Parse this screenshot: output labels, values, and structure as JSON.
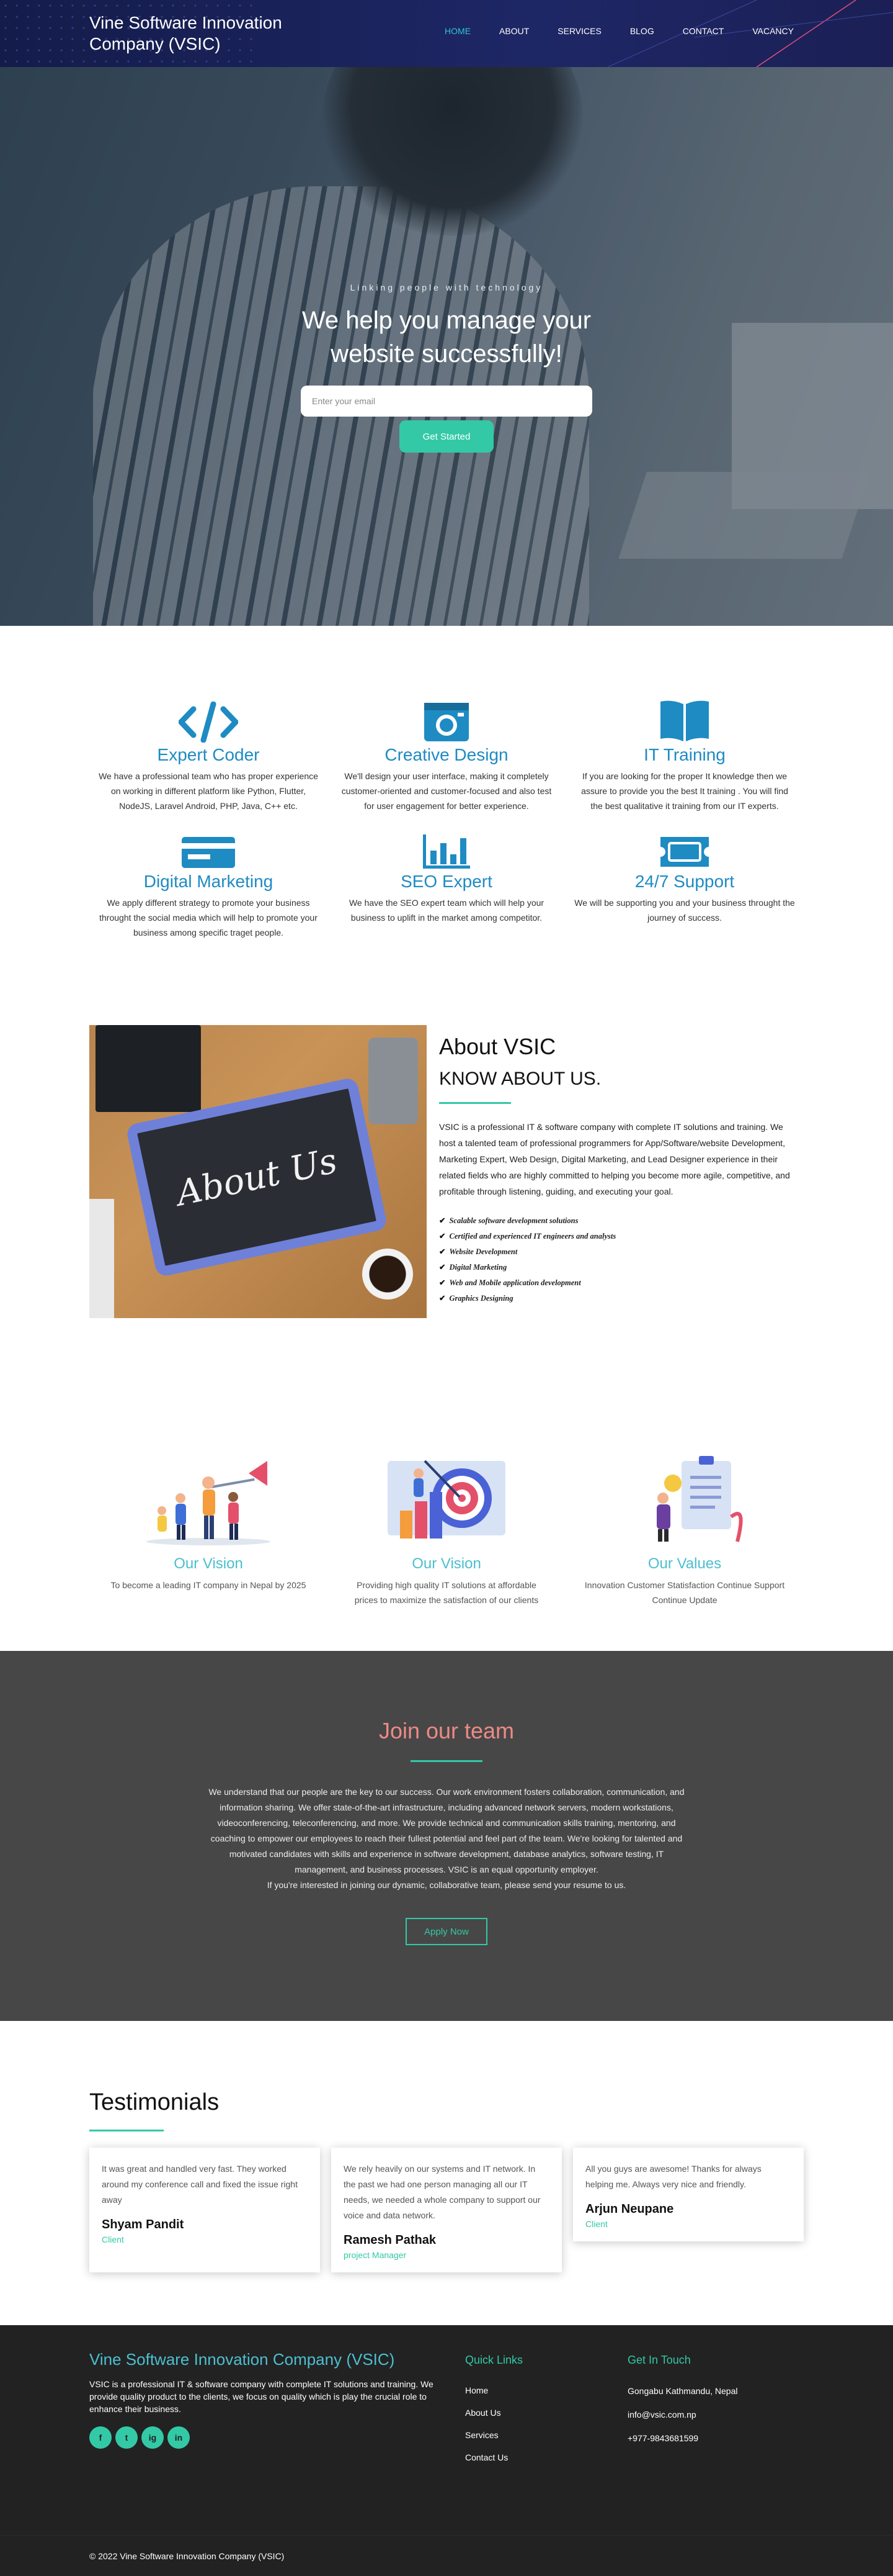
{
  "nav": {
    "brand": "Vine Software Innovation Company (VSIC)",
    "items": [
      {
        "label": "HOME",
        "active": true
      },
      {
        "label": "ABOUT"
      },
      {
        "label": "SERVICES"
      },
      {
        "label": "BLOG"
      },
      {
        "label": "CONTACT"
      },
      {
        "label": "VACANCY"
      }
    ]
  },
  "hero": {
    "tagline": "Linking people with technology",
    "title": "We help you manage your website successfully!",
    "email_placeholder": "Enter your email",
    "button": "Get Started"
  },
  "services": [
    {
      "icon": "code-icon",
      "title": "Expert Coder",
      "text": "We have a professional team who has proper experience on working in different platform like Python, Flutter, NodeJS, Laravel Android, PHP, Java, C++ etc."
    },
    {
      "icon": "camera-icon",
      "title": "Creative Design",
      "text": "We'll design your user interface, making it completely customer-oriented and customer-focused and also test for user engagement for better experience."
    },
    {
      "icon": "book-icon",
      "title": "IT Training",
      "text": "If you are looking for the proper It knowledge then we assure to provide you the best It training . You will find the best qualitative it training from our IT experts."
    },
    {
      "icon": "card-icon",
      "title": "Digital Marketing",
      "text": "We apply different strategy to promote your business throught the social media which will help to promote your business among specific traget people."
    },
    {
      "icon": "bar-chart-icon",
      "title": "SEO Expert",
      "text": "We have the SEO expert team which will help your business to uplift in the market among competitor."
    },
    {
      "icon": "ticket-icon",
      "title": "24/7 Support",
      "text": "We will be supporting you and your business throught the journey of success."
    }
  ],
  "about": {
    "image_text": "About Us",
    "title": "About VSIC",
    "subtitle": "KNOW ABOUT US.",
    "body": "VSIC is a professional IT & software company with complete IT solutions and training. We host a talented team of professional programmers for App/Software/website Development, Marketing Expert, Web Design, Digital Marketing, and Lead Designer experience in their related fields who are highly committed to helping you become more agile, competitive, and profitable through listening, guiding, and executing your goal.",
    "features": [
      "Scalable software development solutions",
      "Certified and experienced IT engineers and analysts",
      "Website  Development",
      "Digital Marketing",
      "Web and Mobile application development",
      "Graphics Designing"
    ]
  },
  "values": [
    {
      "title": "Our Vision",
      "text": "To become a leading IT company in Nepal by 2025"
    },
    {
      "title": "Our Vision",
      "text": "Providing high quality IT solutions at affordable prices to maximize the satisfaction of our clients"
    },
    {
      "title": "Our Values",
      "text": "Innovation Customer Statisfaction Continue Support Continue Update"
    }
  ],
  "join": {
    "title": "Join our team",
    "body": "We understand that our people are the key to our success. Our work environment fosters collaboration, communication, and information sharing. We offer state-of-the-art infrastructure, including advanced network servers, modern workstations, videoconferencing, teleconferencing, and more. We provide technical and communication skills training, mentoring, and coaching to empower our employees to reach their fullest potential and feel part of the team. We're looking for talented and motivated candidates with skills and experience in software development, database analytics, software testing, IT management, and business processes. VSIC is an equal opportunity employer.",
    "body2": "If you're interested in joining our dynamic, collaborative team, please send your resume to us.",
    "button": "Apply Now"
  },
  "testimonials": {
    "title": "Testimonials",
    "items": [
      {
        "text": "It was great and handled very fast. They worked around my conference call and fixed the issue right away",
        "name": "Shyam Pandit",
        "role": "Client"
      },
      {
        "text": "We rely heavily on our systems and IT network. In the past we had one person managing all our IT needs, we needed a whole company to support our voice and data network.",
        "name": "Ramesh Pathak",
        "role": "project Manager"
      },
      {
        "text": "All you guys are awesome! Thanks for always helping me. Always very nice and friendly.",
        "name": "Arjun Neupane",
        "role": "Client"
      }
    ]
  },
  "footer": {
    "brand": "Vine Software Innovation Company (VSIC)",
    "about": "VSIC is a professional IT & software company with complete IT solutions and training. We provide quality product to the clients, we focus on quality which is play the crucial role to enhance their business.",
    "social": [
      "f",
      "t",
      "ig",
      "in"
    ],
    "quick_title": "Quick Links",
    "quick_links": [
      "Home",
      "About Us",
      "Services",
      "Contact Us"
    ],
    "contact_title": "Get In Touch",
    "address": "Gongabu Kathmandu, Nepal",
    "email": "info@vsic.com.np",
    "phone": "+977-9843681599",
    "copyright": "© 2022 Vine Software Innovation Company (VSIC)"
  },
  "colors": {
    "accent": "#33c9a6",
    "service_blue": "#1e8bc3",
    "nav_bg": "#1e2766",
    "join_title": "#ec8a86"
  }
}
